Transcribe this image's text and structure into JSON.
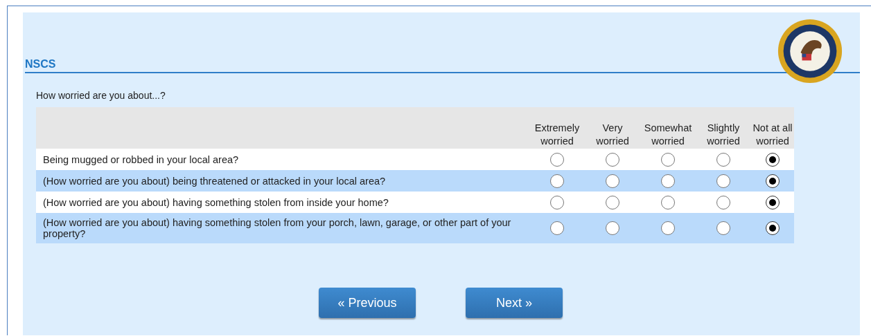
{
  "header": {
    "title": "NSCS"
  },
  "question": "How worried are you about...?",
  "columns": [
    "Extremely worried",
    "Very worried",
    "Somewhat worried",
    "Slightly worried",
    "Not at all worried"
  ],
  "rows": [
    {
      "label": "Being mugged or robbed in your local area?",
      "options": [
        {
          "selected": false
        },
        {
          "selected": false
        },
        {
          "selected": false
        },
        {
          "selected": false
        },
        {
          "selected": true
        }
      ]
    },
    {
      "label": "(How worried are you about) being threatened or attacked in your local area?",
      "options": [
        {
          "selected": false
        },
        {
          "selected": false
        },
        {
          "selected": false
        },
        {
          "selected": false
        },
        {
          "selected": true
        }
      ]
    },
    {
      "label": "(How worried are you about) having something stolen from inside your home?",
      "options": [
        {
          "selected": false
        },
        {
          "selected": false
        },
        {
          "selected": false
        },
        {
          "selected": false
        },
        {
          "selected": true
        }
      ]
    },
    {
      "label": "(How worried are you about) having something stolen from your porch, lawn, garage, or other part of your property?",
      "options": [
        {
          "selected": false
        },
        {
          "selected": false
        },
        {
          "selected": false
        },
        {
          "selected": false
        },
        {
          "selected": true
        }
      ]
    }
  ],
  "buttons": [
    {
      "label": "« Previous"
    },
    {
      "label": "Next »"
    }
  ]
}
